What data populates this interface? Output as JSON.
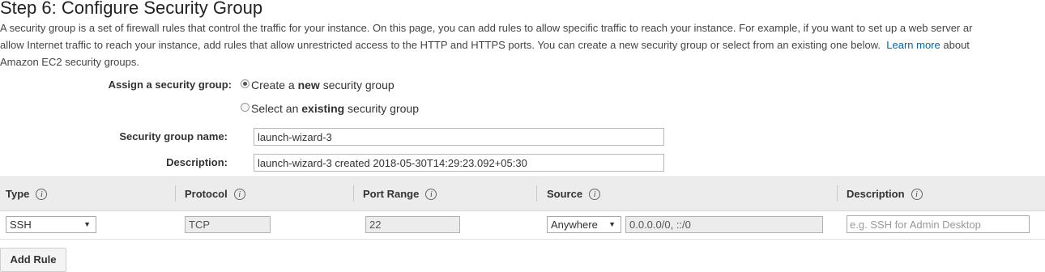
{
  "page": {
    "title": "Step 6: Configure Security Group",
    "intro_line1": "A security group is a set of firewall rules that control the traffic for your instance. On this page, you can add rules to allow specific traffic to reach your instance. For example, if you want to set up a web server ar",
    "intro_line2_pre": "allow Internet traffic to reach your instance, add rules that allow unrestricted access to the HTTP and HTTPS ports. You can create a new security group or select from an existing one below.",
    "learn_more": "Learn more",
    "intro_line2_post": "about",
    "intro_line3": "Amazon EC2 security groups."
  },
  "assign": {
    "label": "Assign a security group:",
    "options": [
      {
        "pre": "Create a ",
        "bold": "new",
        "post": " security group",
        "checked": true
      },
      {
        "pre": "Select an ",
        "bold": "existing",
        "post": " security group",
        "checked": false
      }
    ]
  },
  "group_name": {
    "label": "Security group name:",
    "value": "launch-wizard-3"
  },
  "description": {
    "label": "Description:",
    "value": "launch-wizard-3 created 2018-05-30T14:29:23.092+05:30"
  },
  "table": {
    "columns": [
      "Type",
      "Protocol",
      "Port Range",
      "Source",
      "Description"
    ],
    "info_glyph": "i",
    "rows": [
      {
        "type": "SSH",
        "protocol": "TCP",
        "port_range": "22",
        "source": "Anywhere",
        "source_cidr": "0.0.0.0/0, ::/0",
        "description_placeholder": "e.g. SSH for Admin Desktop"
      }
    ]
  },
  "add_rule_label": "Add Rule",
  "icons": {
    "dropdown_arrow": "▼",
    "info": "info-icon"
  }
}
